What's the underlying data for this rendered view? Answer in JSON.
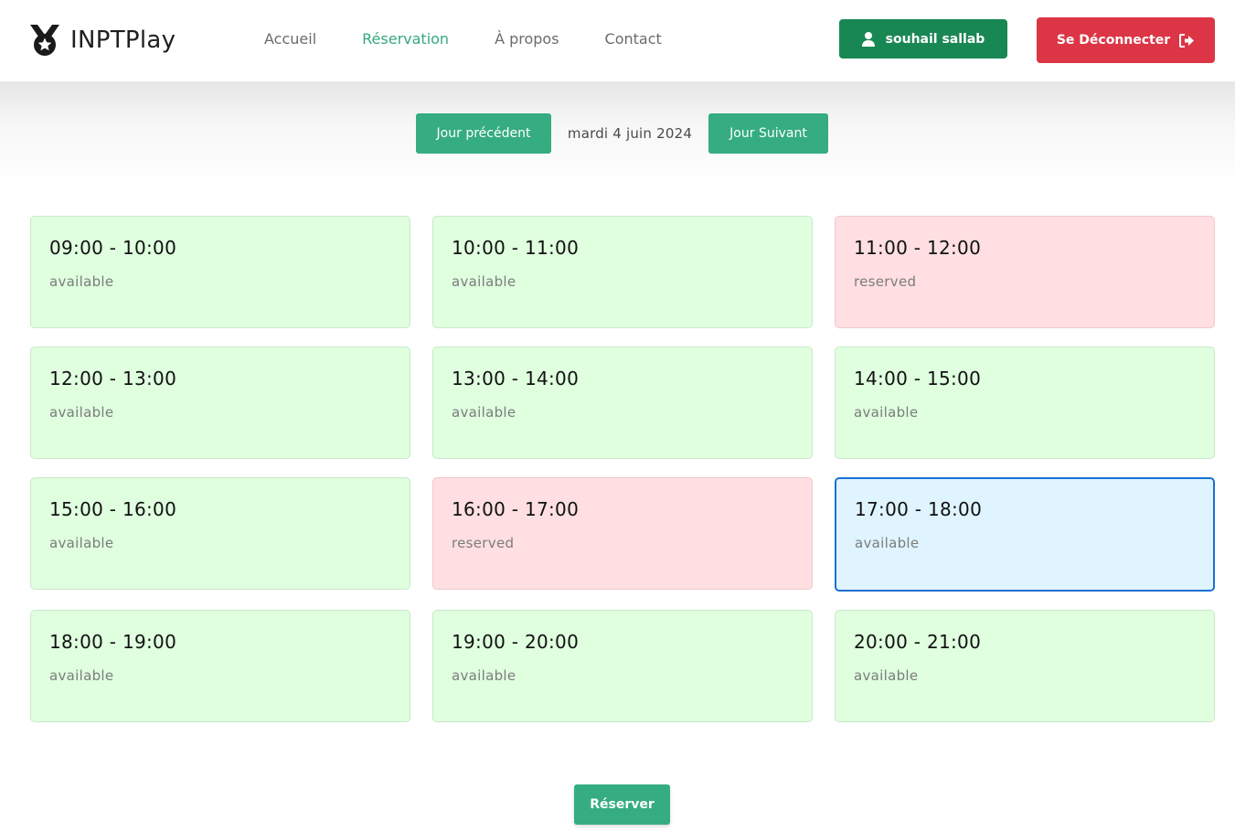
{
  "header": {
    "brand": "INPTPlay",
    "nav": [
      "Accueil",
      "Réservation",
      "À propos",
      "Contact"
    ],
    "active_nav": "Réservation",
    "user_label": "souhail sallab",
    "logout_label": "Se Déconnecter"
  },
  "day_nav": {
    "prev_label": "Jour précédent",
    "date_label": "mardi 4 juin 2024",
    "next_label": "Jour Suivant"
  },
  "slots": [
    {
      "time": "09:00 - 10:00",
      "status": "available"
    },
    {
      "time": "10:00 - 11:00",
      "status": "available"
    },
    {
      "time": "11:00 - 12:00",
      "status": "reserved"
    },
    {
      "time": "12:00 - 13:00",
      "status": "available"
    },
    {
      "time": "13:00 - 14:00",
      "status": "available"
    },
    {
      "time": "14:00 - 15:00",
      "status": "available"
    },
    {
      "time": "15:00 - 16:00",
      "status": "available"
    },
    {
      "time": "16:00 - 17:00",
      "status": "reserved"
    },
    {
      "time": "17:00 - 18:00",
      "status": "available",
      "selected": true
    },
    {
      "time": "18:00 - 19:00",
      "status": "available"
    },
    {
      "time": "19:00 - 20:00",
      "status": "available"
    },
    {
      "time": "20:00 - 21:00",
      "status": "available"
    }
  ],
  "reserve_label": "Réserver",
  "colors": {
    "accent": "#35ad80",
    "user_button": "#198754",
    "logout_button": "#dc3545",
    "available_bg": "#dfffdf",
    "reserved_bg": "#ffdfe1",
    "selected_bg": "#dff4ff",
    "selected_border": "#1a6fd4"
  },
  "icons": {
    "brand": "medal-icon",
    "user": "user-icon",
    "logout": "sign-out-icon"
  }
}
